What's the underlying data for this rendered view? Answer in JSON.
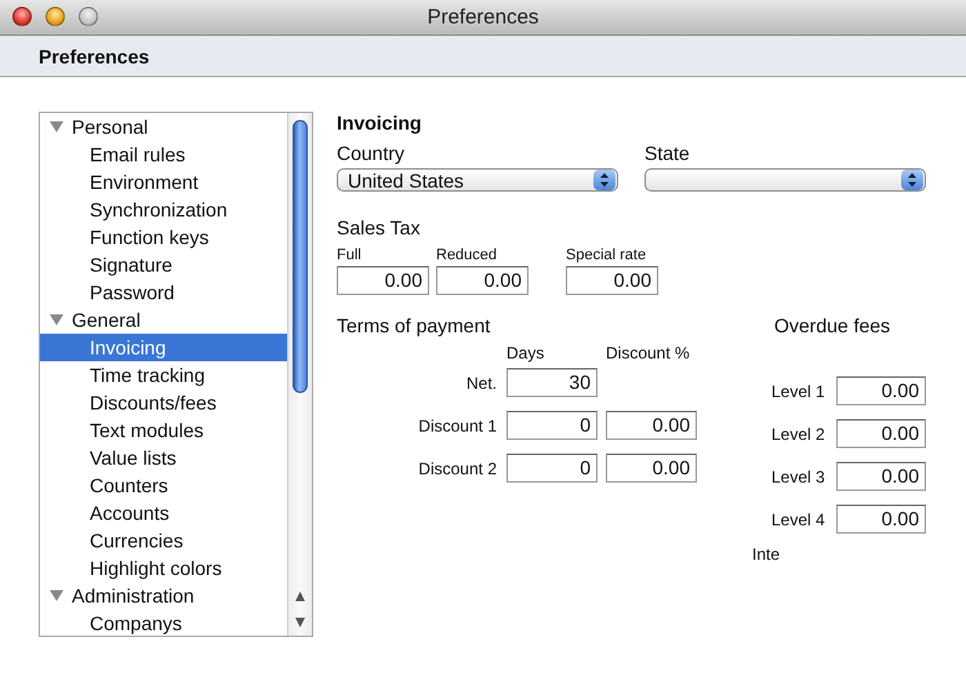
{
  "window": {
    "title": "Preferences"
  },
  "toolbar": {
    "title": "Preferences"
  },
  "sidebar": {
    "items": [
      {
        "label": "Personal",
        "expanded": true,
        "selected": false,
        "children": [
          {
            "label": "Email rules",
            "selected": false
          },
          {
            "label": "Environment",
            "selected": false
          },
          {
            "label": "Synchronization",
            "selected": false
          },
          {
            "label": "Function keys",
            "selected": false
          },
          {
            "label": "Signature",
            "selected": false
          },
          {
            "label": "Password",
            "selected": false
          }
        ]
      },
      {
        "label": "General",
        "expanded": true,
        "selected": false,
        "children": [
          {
            "label": "Invoicing",
            "selected": true
          },
          {
            "label": "Time tracking",
            "selected": false
          },
          {
            "label": "Discounts/fees",
            "selected": false
          },
          {
            "label": "Text modules",
            "selected": false
          },
          {
            "label": "Value lists",
            "selected": false
          },
          {
            "label": "Counters",
            "selected": false
          },
          {
            "label": "Accounts",
            "selected": false
          },
          {
            "label": "Currencies",
            "selected": false
          },
          {
            "label": "Highlight colors",
            "selected": false
          }
        ]
      },
      {
        "label": "Administration",
        "expanded": true,
        "selected": false,
        "children": [
          {
            "label": "Companys",
            "selected": false
          }
        ]
      }
    ]
  },
  "invoicing": {
    "heading": "Invoicing",
    "country": {
      "label": "Country",
      "value": "United States"
    },
    "state": {
      "label": "State"
    },
    "sales_tax": {
      "heading": "Sales Tax",
      "fields": [
        {
          "label": "Full",
          "value": "0.00"
        },
        {
          "label": "Reduced",
          "value": "0.00"
        },
        {
          "label": "Special rate",
          "value": "0.00"
        }
      ]
    },
    "terms_of_payment": {
      "heading": "Terms of payment",
      "columns": [
        "Days",
        "Discount %"
      ],
      "rows": [
        {
          "label": "Net.",
          "days": "30"
        },
        {
          "label": "Discount 1",
          "days": "0",
          "discount": "0.00"
        },
        {
          "label": "Discount 2",
          "days": "0",
          "discount": "0.00"
        }
      ]
    },
    "overdue_fees": {
      "heading": "Overdue fees",
      "levels": [
        {
          "label": "Level 1",
          "value": "0.00"
        },
        {
          "label": "Level 2",
          "value": "0.00"
        },
        {
          "label": "Level 3",
          "value": "0.00"
        },
        {
          "label": "Level 4",
          "value": "0.00"
        }
      ],
      "extra_label": "Inte"
    }
  }
}
